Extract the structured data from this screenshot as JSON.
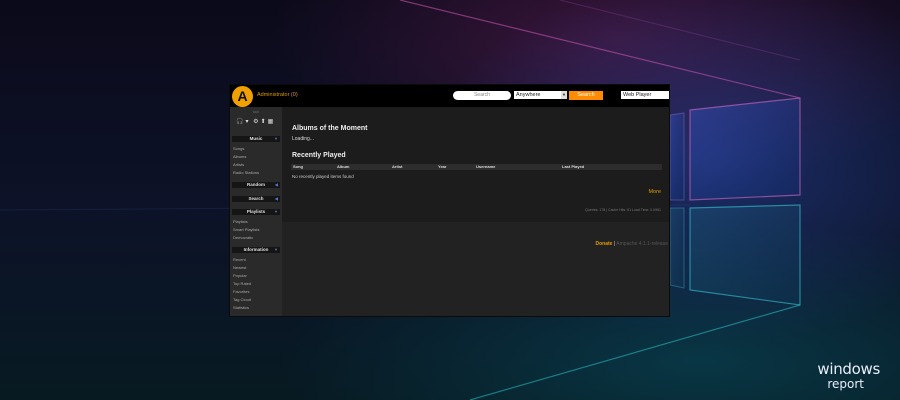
{
  "app": {
    "logo_letter": "A",
    "user_label": "Administrator (0)"
  },
  "topbar": {
    "search_placeholder": "Search",
    "search_scope": "Anywhere",
    "search_button": "Search",
    "player_mode": "Web Player"
  },
  "sidebar": {
    "top_label": "tool",
    "sections": {
      "music": {
        "title": "Music",
        "items": [
          "Songs",
          "Albums",
          "Artists",
          "Radio Stations"
        ]
      },
      "random": {
        "title": "Random"
      },
      "search": {
        "title": "Search"
      },
      "playlists": {
        "title": "Playlists",
        "items": [
          "Playlists",
          "Smart Playlists",
          "Democratic"
        ]
      },
      "information": {
        "title": "Information",
        "items": [
          "Recent",
          "Newest",
          "Popular",
          "Top Rated",
          "Favorites",
          "Tag Cloud",
          "Statistics"
        ]
      }
    }
  },
  "main": {
    "albums_heading": "Albums of the Moment",
    "loading_text": "Loading...",
    "recent_heading": "Recently Played",
    "columns": [
      "Song",
      "Album",
      "Artist",
      "Year",
      "Username",
      "Last Played"
    ],
    "empty_text": "No recently played items found",
    "more_link": "More",
    "stats_text": "Queries: 178 | Cache Hits: 51 Load Time: 0.0961",
    "donate_link": "Donate",
    "separator": "|",
    "version_text": "Ampache 4.1.1-release"
  },
  "desktop": {
    "brand_line1": "windows",
    "brand_line2": "report"
  }
}
